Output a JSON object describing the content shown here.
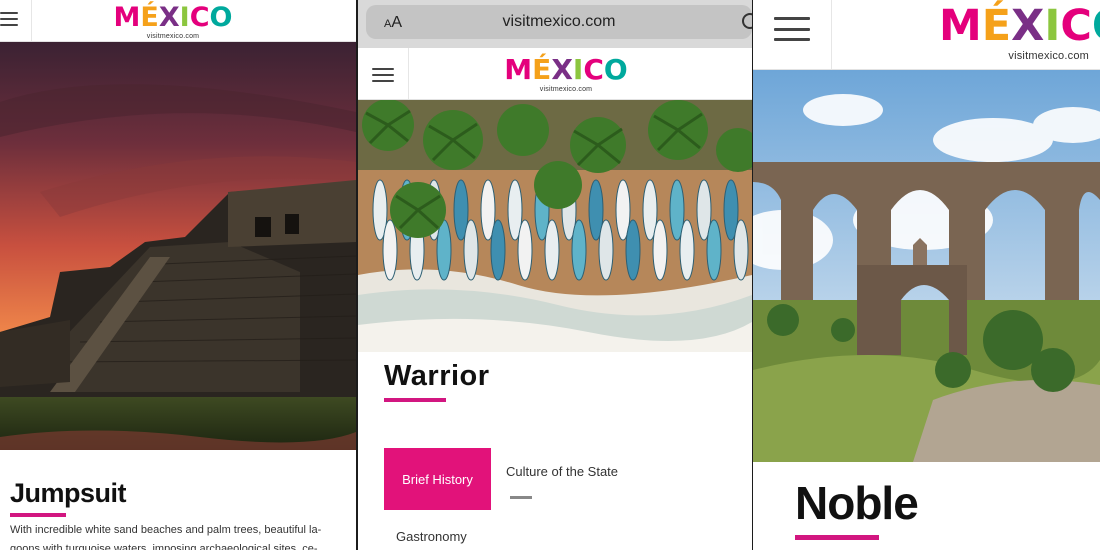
{
  "brand": {
    "logo_letters": [
      {
        "char": "M",
        "color": "#e4007c"
      },
      {
        "char": "É",
        "color": "#f5a11a"
      },
      {
        "char": "X",
        "color": "#7a2f86"
      },
      {
        "char": "I",
        "color": "#8cc63f"
      },
      {
        "char": "C",
        "color": "#e4007c"
      },
      {
        "char": "O",
        "color": "#00a99d"
      }
    ],
    "website": "visitmexico.com",
    "accent_color": "#e2127a"
  },
  "panel1": {
    "menu_icon": "hamburger-icon",
    "title": "Jumpsuit",
    "description": "With incredible white sand beaches and palm trees, beautiful la- goons with turquoise waters, imposing archaeological sites, ce-",
    "image": "mayan-pyramid-at-sunset"
  },
  "panel2": {
    "browser": {
      "text_size_label": "AA",
      "url": "visitmexico.com",
      "reload_icon": "reload-icon"
    },
    "menu_icon": "hamburger-icon",
    "image": "aerial-beach-boats-palms",
    "title": "Warrior",
    "tabs": [
      {
        "label": "Brief History",
        "active": true
      },
      {
        "label": "Culture of the State",
        "active": false
      },
      {
        "label": "Gastronomy",
        "active": false
      }
    ]
  },
  "panel3": {
    "menu_icon": "hamburger-icon",
    "image": "stone-aqueduct-arches",
    "title": "Noble"
  }
}
